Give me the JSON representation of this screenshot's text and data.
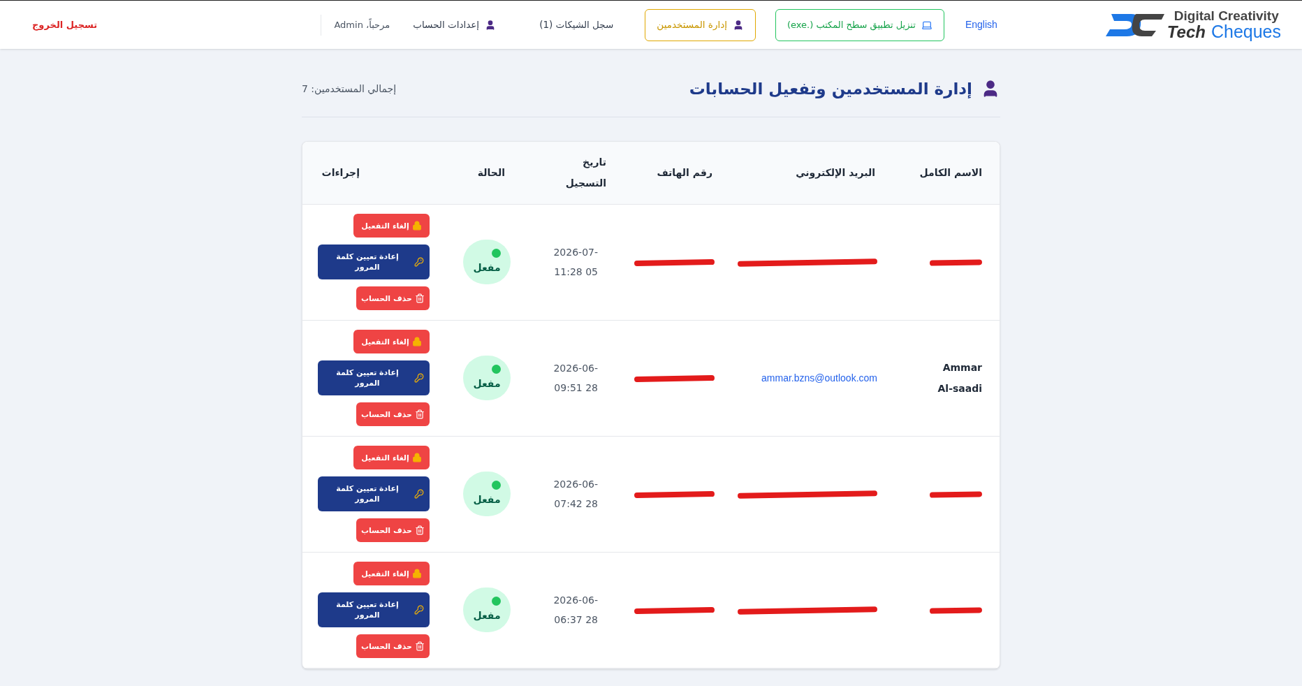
{
  "brand": {
    "line1": "Digital Creativity",
    "line2_a": "Tech",
    "line2_b": "Cheques"
  },
  "nav": {
    "language": "English",
    "download": "تنزيل تطبيق سطح المكتب (.exe)",
    "links": [
      {
        "label": "إدارة المستخدمين",
        "selected": true,
        "has_icon": true
      },
      {
        "label": "سجل الشيكات (1)",
        "selected": false,
        "has_icon": false
      },
      {
        "label": "إعدادات الحساب",
        "selected": false,
        "has_icon": true
      }
    ],
    "greeting": "مرحباً، Admin",
    "logout": "تسجيل الخروج"
  },
  "page": {
    "title": "إدارة المستخدمين وتفعيل الحسابات",
    "total": "إجمالي المستخدمين: 7"
  },
  "table": {
    "columns": [
      "الاسم الكامل",
      "البريد الإلكتروني",
      "رقم الهاتف",
      "تاريخ التسجيل",
      "الحالة",
      "إجراءات"
    ],
    "rows": [
      {
        "name": {
          "redacted": true
        },
        "email": {
          "redacted": true
        },
        "phone": {
          "redacted": true
        },
        "date": "2026-07-05 11:28",
        "status": {
          "label": "مفعل",
          "active": true
        },
        "actions": [
          {
            "kind": "deactivate",
            "label": "إلغاء التفعيل"
          },
          {
            "kind": "reset",
            "label": "إعادة تعيين كلمة المرور"
          },
          {
            "kind": "delete",
            "label": "حذف الحساب"
          }
        ]
      },
      {
        "name": {
          "text": "Ammar Al-saadi",
          "redacted": false
        },
        "email": {
          "text": "ammar.bzns@outlook.com",
          "redacted": false
        },
        "phone": {
          "redacted": true
        },
        "date": "2026-06-28 09:51",
        "status": {
          "label": "مفعل",
          "active": true
        },
        "actions": [
          {
            "kind": "deactivate",
            "label": "إلغاء التفعيل"
          },
          {
            "kind": "reset",
            "label": "إعادة تعيين كلمة المرور"
          },
          {
            "kind": "delete",
            "label": "حذف الحساب"
          }
        ]
      },
      {
        "name": {
          "redacted": true
        },
        "email": {
          "redacted": true
        },
        "phone": {
          "redacted": true
        },
        "date": "2026-06-28 07:42",
        "status": {
          "label": "مفعل",
          "active": true
        },
        "actions": [
          {
            "kind": "deactivate",
            "label": "إلغاء التفعيل"
          },
          {
            "kind": "reset",
            "label": "إعادة تعيين كلمة المرور"
          },
          {
            "kind": "delete",
            "label": "حذف الحساب"
          }
        ]
      },
      {
        "name": {
          "redacted": true
        },
        "email": {
          "redacted": true
        },
        "phone": {
          "redacted": true
        },
        "date": "2026-06-28 06:37",
        "status": {
          "label": "مفعل",
          "active": true
        },
        "actions": [
          {
            "kind": "deactivate",
            "label": "إلغاء التفعيل"
          },
          {
            "kind": "reset",
            "label": "إعادة تعيين كلمة المرور"
          },
          {
            "kind": "delete",
            "label": "حذف الحساب"
          }
        ]
      }
    ]
  }
}
